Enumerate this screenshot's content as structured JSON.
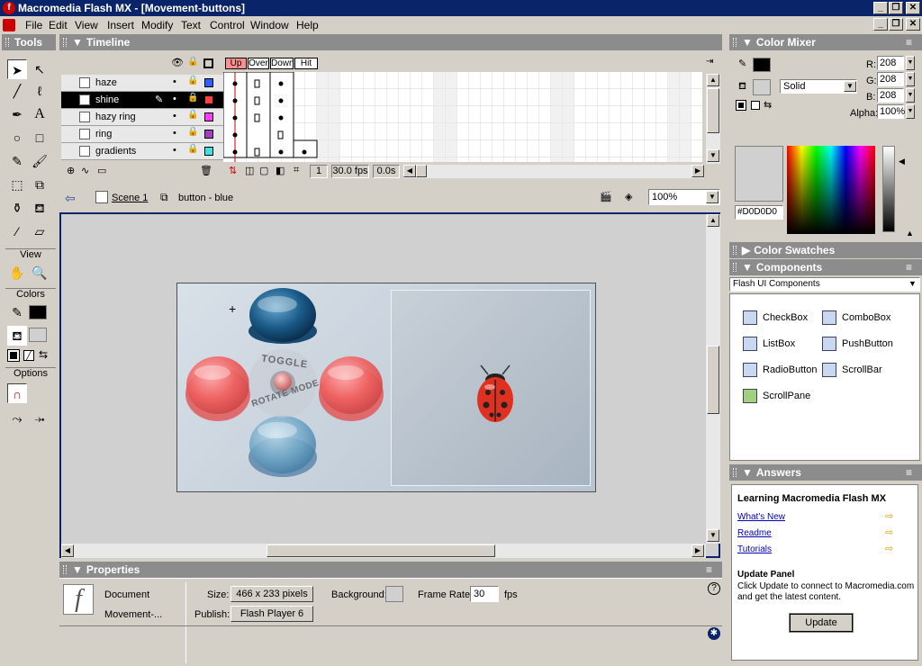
{
  "window": {
    "title": "Macromedia Flash MX - [Movement-buttons]"
  },
  "menu": [
    "File",
    "Edit",
    "View",
    "Insert",
    "Modify",
    "Text",
    "Control",
    "Window",
    "Help"
  ],
  "tools": {
    "title": "Tools",
    "view_label": "View",
    "colors_label": "Colors",
    "options_label": "Options"
  },
  "timeline": {
    "title": "Timeline",
    "frame_labels": [
      "Up",
      "Over",
      "Down",
      "Hit"
    ],
    "layers": [
      {
        "name": "haze",
        "color": "#3060ff"
      },
      {
        "name": "shine",
        "color": "#ff4040"
      },
      {
        "name": "hazy ring",
        "color": "#ff40ff"
      },
      {
        "name": "ring",
        "color": "#a040c0"
      },
      {
        "name": "gradients",
        "color": "#40e0e0"
      }
    ],
    "current_frame": "1",
    "fps": "30.0 fps",
    "time": "0.0s"
  },
  "edit_bar": {
    "scene": "Scene 1",
    "symbol": "button - blue",
    "zoom": "100%"
  },
  "stage": {
    "toggle_text": "TOGGLE",
    "rotate_text": "ROTATE MODE"
  },
  "properties": {
    "title": "Properties",
    "doc_type": "Document",
    "doc_name": "Movement-...",
    "size_label": "Size:",
    "size_value": "466 x 233 pixels",
    "publish_label": "Publish:",
    "publish_value": "Flash Player 6",
    "background_label": "Background:",
    "framerate_label": "Frame Rate:",
    "framerate_value": "30",
    "fps_unit": "fps"
  },
  "color_mixer": {
    "title": "Color Mixer",
    "r_label": "R:",
    "r": "208",
    "g_label": "G:",
    "g": "208",
    "b_label": "B:",
    "b": "208",
    "alpha_label": "Alpha:",
    "alpha": "100%",
    "fill_type": "Solid",
    "hex": "#D0D0D0"
  },
  "color_swatches": {
    "title": "Color Swatches"
  },
  "components": {
    "title": "Components",
    "set": "Flash UI Components",
    "items": [
      "CheckBox",
      "ComboBox",
      "ListBox",
      "PushButton",
      "RadioButton",
      "ScrollBar",
      "ScrollPane"
    ]
  },
  "answers": {
    "title": "Answers",
    "heading": "Learning Macromedia Flash MX",
    "links": [
      "What's New",
      "Readme",
      "Tutorials"
    ],
    "update_title": "Update Panel",
    "update_text": "Click Update to connect to Macromedia.com and get the latest content.",
    "update_button": "Update"
  }
}
